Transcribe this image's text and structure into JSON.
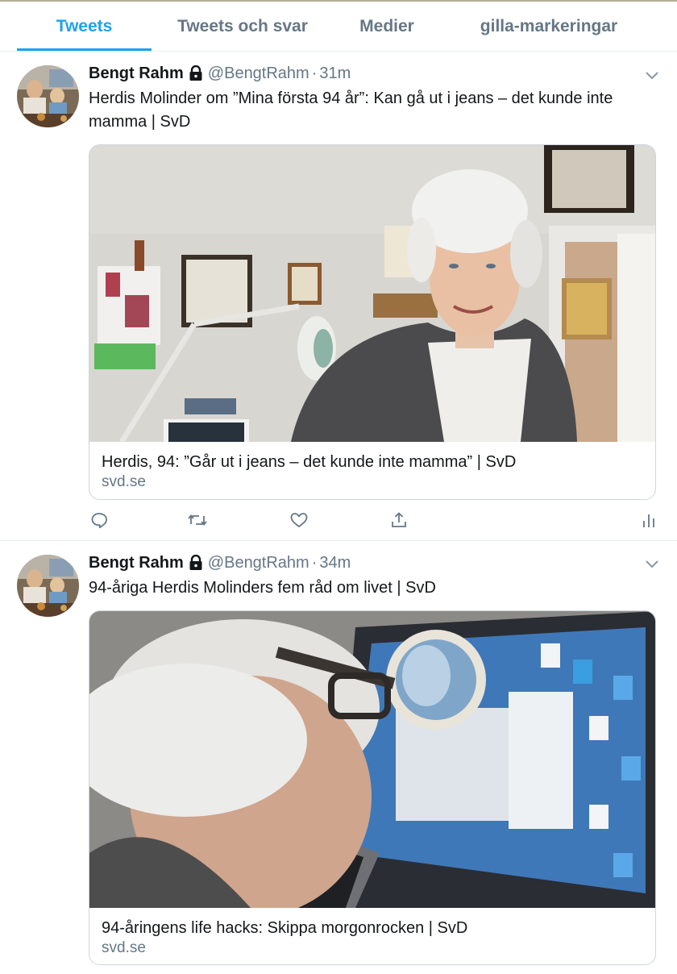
{
  "tabs": {
    "tweets": "Tweets",
    "tweets_replies": "Tweets och svar",
    "media": "Medier",
    "likes": "gilla-markeringar"
  },
  "colors": {
    "accent": "#1da1f2",
    "secondary_text": "#657786",
    "border": "#ccd6dd"
  },
  "tweets": [
    {
      "name": "Bengt Rahm",
      "handle": "@BengtRahm",
      "separator": "·",
      "time": "31m",
      "text": "Herdis Molinder om ”Mina första 94 år”: Kan gå ut i jeans – det kunde inte mamma | SvD",
      "card": {
        "title": "Herdis, 94: ”Går ut i jeans – det kunde inte mamma” | SvD",
        "domain": "svd.se"
      },
      "icons": [
        "reply-icon",
        "retweet-icon",
        "like-icon",
        "share-icon",
        "analytics-icon"
      ]
    },
    {
      "name": "Bengt Rahm",
      "handle": "@BengtRahm",
      "separator": "·",
      "time": "34m",
      "text": "94-åriga Herdis Molinders fem råd om livet | SvD",
      "card": {
        "title": "94-åringens life hacks: Skippa morgonrocken | SvD",
        "domain": "svd.se"
      }
    }
  ]
}
